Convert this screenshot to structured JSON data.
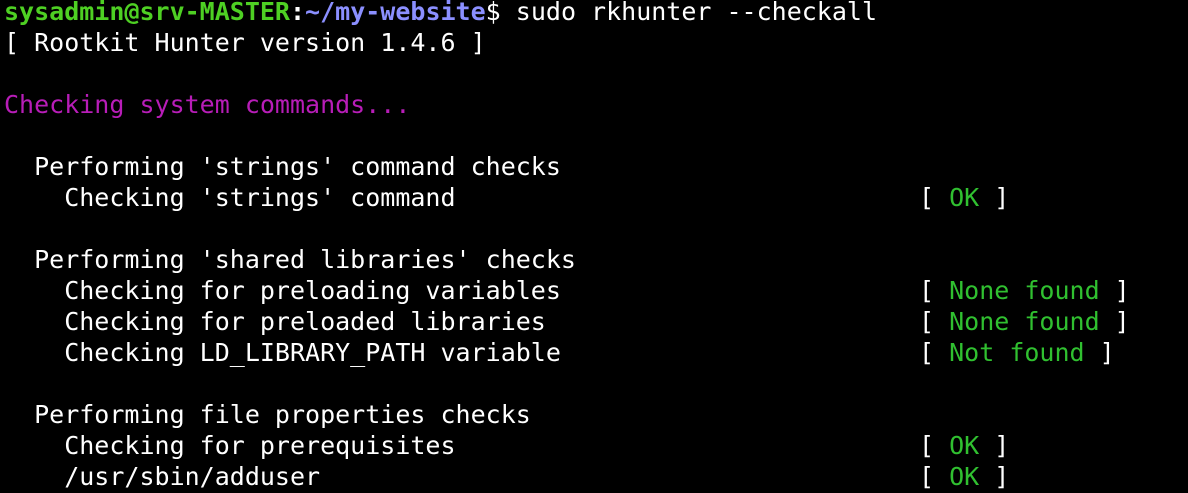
{
  "prompt": {
    "user_host": "sysadmin@srv-MASTER",
    "separator": ":",
    "path": "~/my-website",
    "symbol": "$",
    "command": " sudo rkhunter --checkall"
  },
  "version_line": "[ Rootkit Hunter version 1.4.6 ]",
  "section_title": "Checking system commands...",
  "groups": [
    {
      "heading": "  Performing 'strings' command checks",
      "checks": [
        {
          "label": "    Checking 'strings' command",
          "result": "OK"
        }
      ]
    },
    {
      "heading": "  Performing 'shared libraries' checks",
      "checks": [
        {
          "label": "    Checking for preloading variables",
          "result": "None found"
        },
        {
          "label": "    Checking for preloaded libraries",
          "result": "None found"
        },
        {
          "label": "    Checking LD_LIBRARY_PATH variable",
          "result": "Not found"
        }
      ]
    },
    {
      "heading": "  Performing file properties checks",
      "checks": [
        {
          "label": "    Checking for prerequisites",
          "result": "OK"
        },
        {
          "label": "    /usr/sbin/adduser",
          "result": "OK"
        }
      ]
    }
  ],
  "colors": {
    "background": "#000000",
    "text": "#ffffff",
    "user_host": "#4ed023",
    "path": "#8b8fff",
    "section_title": "#b81db8",
    "result": "#30c030"
  }
}
